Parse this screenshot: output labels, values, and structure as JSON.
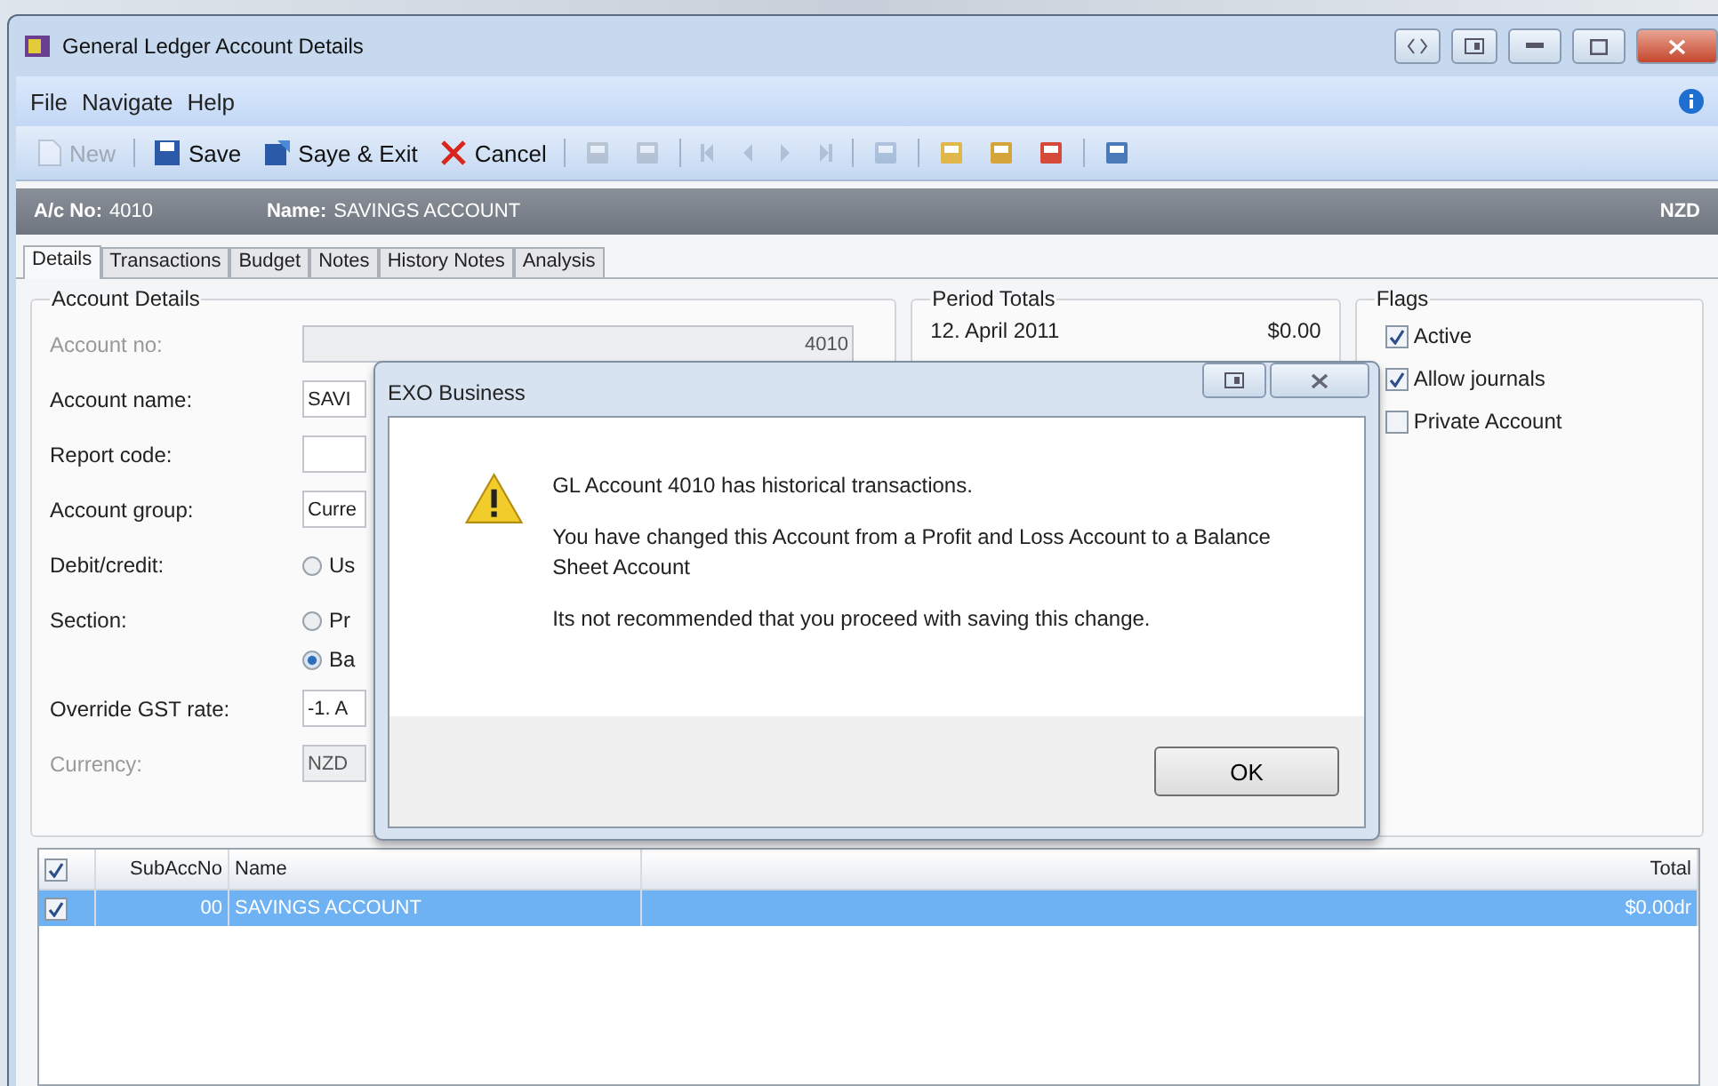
{
  "window": {
    "title": "General Ledger Account Details"
  },
  "menu": [
    "File",
    "Navigate",
    "Help"
  ],
  "toolbar": [
    {
      "kind": "text",
      "label": "New",
      "disabled": true
    },
    {
      "kind": "text",
      "label": "Save",
      "disabled": false
    },
    {
      "kind": "text",
      "label": "Saye & Exit",
      "disabled": false
    },
    {
      "kind": "text",
      "label": "Cancel",
      "disabled": false
    },
    {
      "kind": "icon",
      "disabled": true
    },
    {
      "kind": "icon",
      "disabled": true
    },
    {
      "kind": "icon",
      "disabled": true
    },
    {
      "kind": "icon",
      "disabled": true
    },
    {
      "kind": "icon",
      "disabled": true
    },
    {
      "kind": "icon",
      "disabled": true
    },
    {
      "kind": "icon",
      "disabled": true
    },
    {
      "kind": "icon",
      "disabled": false
    },
    {
      "kind": "icon",
      "disabled": false
    },
    {
      "kind": "icon",
      "disabled": false
    },
    {
      "kind": "icon",
      "disabled": false
    }
  ],
  "header": {
    "ac_label": "A/c No:",
    "ac_value": "4010",
    "name_label": "Name:",
    "name_value": "SAVINGS ACCOUNT",
    "currency": "NZD"
  },
  "tabs": [
    {
      "label": "Details",
      "selected": true
    },
    {
      "label": "Transactions",
      "selected": false
    },
    {
      "label": "Budget",
      "selected": false
    },
    {
      "label": "Notes",
      "selected": false
    },
    {
      "label": "History Notes",
      "selected": false
    },
    {
      "label": "Analysis",
      "selected": false
    }
  ],
  "account_details": {
    "title": "Account Details",
    "fields": [
      {
        "kind": "text",
        "label": "Account no:",
        "value": "4010",
        "disabled": true
      },
      {
        "kind": "text",
        "label": "Account name:",
        "value": "SAVI",
        "disabled": false
      },
      {
        "kind": "text",
        "label": "Report code:",
        "disabled": false
      },
      {
        "kind": "text",
        "label": "Account group:",
        "value": "Curre",
        "disabled": false
      },
      {
        "kind": "radio",
        "label": "Debit/credit:",
        "disabled": false,
        "options": [
          {
            "label": "Us",
            "selected": false
          }
        ]
      },
      {
        "kind": "radio",
        "label": "Section:",
        "disabled": false,
        "options": [
          {
            "label": "Pr",
            "selected": false
          },
          {
            "label": "Ba",
            "selected": true
          }
        ]
      },
      {
        "kind": "text",
        "label": "Override GST rate:",
        "value": "-1. A",
        "disabled": false
      },
      {
        "kind": "text",
        "label": "Currency:",
        "value": "NZD",
        "disabled": true
      }
    ]
  },
  "period_totals": {
    "title": "Period Totals",
    "rows": [
      {
        "period": "12. April 2011",
        "amount": "$0.00"
      }
    ]
  },
  "flags": {
    "title": "Flags",
    "items": [
      {
        "label": "Active",
        "checked": true
      },
      {
        "label": "Allow journals",
        "checked": true
      },
      {
        "label": "Private Account",
        "checked": false
      }
    ]
  },
  "grid": {
    "all_checked": true,
    "columns": [
      "SubAccNo",
      "Name",
      "Total"
    ],
    "rows": [
      {
        "checked": true,
        "selected": true,
        "subaccno": "00",
        "name": "SAVINGS ACCOUNT",
        "total": "$0.00dr"
      }
    ]
  },
  "dialog": {
    "title": "EXO Business",
    "messages": [
      "GL Account 4010 has historical transactions.",
      "You have changed this Account from a Profit and Loss Account to a Balance Sheet Account",
      "Its not recommended that you proceed with saving this change."
    ],
    "button": "OK"
  }
}
